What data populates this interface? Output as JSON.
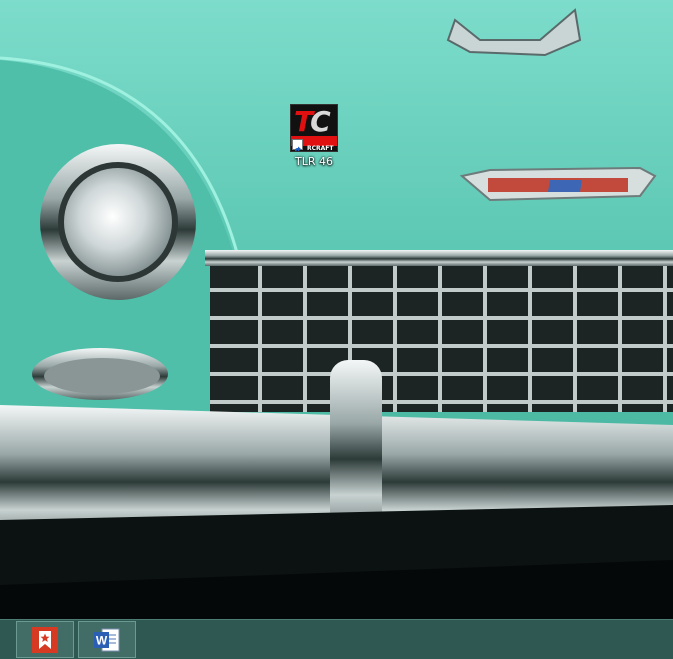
{
  "desktop": {
    "icons": [
      {
        "label": "TLR 46",
        "icon": "tcraft-app-icon",
        "brand_text": "RCRAFT",
        "logo_letters": "TC"
      }
    ]
  },
  "taskbar": {
    "buttons": [
      {
        "icon": "bookmark-star-icon"
      },
      {
        "icon": "word-document-icon",
        "letter": "W"
      }
    ]
  }
}
